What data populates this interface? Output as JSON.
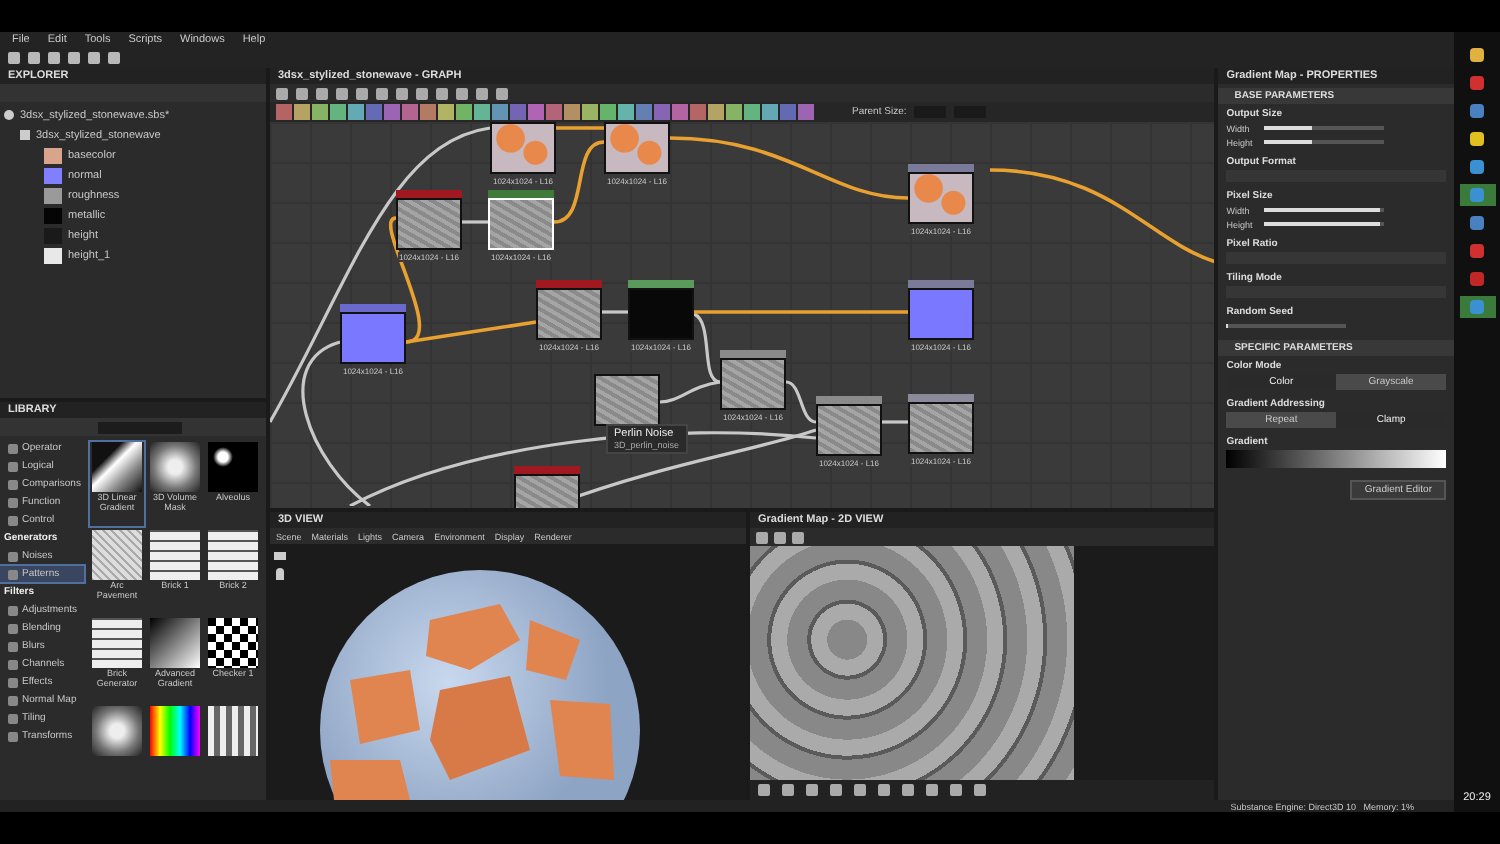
{
  "menu": [
    "File",
    "Edit",
    "Tools",
    "Scripts",
    "Windows",
    "Help"
  ],
  "explorer": {
    "title": "EXPLORER",
    "package": "3dsx_stylized_stonewave.sbs*",
    "graph": "3dsx_stylized_stonewave",
    "outputs": [
      {
        "label": "basecolor",
        "color": "#d9a48c"
      },
      {
        "label": "normal",
        "color": "#7f7fff"
      },
      {
        "label": "roughness",
        "color": "#9a9a9a"
      },
      {
        "label": "metallic",
        "color": "#050505"
      },
      {
        "label": "height",
        "color": "#1a1a1a"
      },
      {
        "label": "height_1",
        "color": "#e8e8e8"
      }
    ]
  },
  "library": {
    "title": "LIBRARY",
    "categories": [
      {
        "kind": "item",
        "label": "Operator",
        "selected": false
      },
      {
        "kind": "item",
        "label": "Logical",
        "selected": false
      },
      {
        "kind": "item",
        "label": "Comparisons",
        "selected": false
      },
      {
        "kind": "item",
        "label": "Function",
        "selected": false
      },
      {
        "kind": "item",
        "label": "Control",
        "selected": false
      },
      {
        "kind": "group",
        "label": "Generators",
        "children": [
          {
            "label": "Noises",
            "selected": false
          },
          {
            "label": "Patterns",
            "selected": true
          }
        ]
      },
      {
        "kind": "group",
        "label": "Filters",
        "children": [
          {
            "label": "Adjustments",
            "selected": false
          },
          {
            "label": "Blending",
            "selected": false
          },
          {
            "label": "Blurs",
            "selected": false
          },
          {
            "label": "Channels",
            "selected": false
          },
          {
            "label": "Effects",
            "selected": false
          },
          {
            "label": "Normal Map",
            "selected": false
          },
          {
            "label": "Tiling",
            "selected": false
          },
          {
            "label": "Transforms",
            "selected": false
          }
        ]
      }
    ],
    "items": [
      {
        "kind": "wedge",
        "label": "3D Linear Gradient",
        "selected": true
      },
      {
        "kind": "cube",
        "label": "3D Volume Mask",
        "selected": false
      },
      {
        "kind": "blobs",
        "label": "Alveolus",
        "selected": false
      },
      {
        "kind": "noise",
        "label": "Arc Pavement",
        "selected": false
      },
      {
        "kind": "bricks",
        "label": "Brick 1",
        "selected": false
      },
      {
        "kind": "bricks",
        "label": "Brick 2",
        "selected": false
      },
      {
        "kind": "bricks",
        "label": "Brick Generator",
        "selected": false
      },
      {
        "kind": "ramp",
        "label": "Advanced Gradient",
        "selected": false
      },
      {
        "kind": "checker",
        "label": "Checker 1",
        "selected": false
      },
      {
        "kind": "cube",
        "selected": false
      },
      {
        "kind": "color",
        "selected": false
      },
      {
        "kind": "stripes",
        "selected": false
      }
    ]
  },
  "graph": {
    "title": "3dsx_stylized_stonewave - GRAPH",
    "parent_size_label": "Parent Size:",
    "nodes": [
      {
        "kind": "stone",
        "caption": "1024x1024 - L16",
        "selected": false
      },
      {
        "kind": "stone",
        "caption": "1024x1024 - L16",
        "selected": false
      },
      {
        "kind": "noise",
        "color": "#a01820",
        "caption": "1024x1024 - L16",
        "selected": false
      },
      {
        "kind": "noise",
        "color": "#3f7a3a",
        "caption": "1024x1024 - L16",
        "selected": true
      },
      {
        "kind": "normal",
        "color": "#6a6acc",
        "caption": "1024x1024 - L16",
        "selected": false
      },
      {
        "kind": "noise",
        "color": "#a01820",
        "caption": "1024x1024 - L16",
        "selected": false
      },
      {
        "kind": "dark",
        "color": "#5a9a5a",
        "caption": "1024x1024 - L16",
        "selected": false
      },
      {
        "kind": "stone",
        "color": "#7a7a9a",
        "caption": "1024x1024 - L16",
        "selected": false
      },
      {
        "kind": "normal",
        "color": "#7a7a9a",
        "caption": "1024x1024 - L16",
        "selected": false
      },
      {
        "kind": "noise",
        "color": "#8a8a8a",
        "caption": "1024x1024 - L16",
        "selected": false
      },
      {
        "kind": "noise",
        "selected": false
      },
      {
        "kind": "noise",
        "color": "#8a8a8a",
        "caption": "1024x1024 - L16",
        "selected": false
      },
      {
        "kind": "noise",
        "color": "#8a8a9a",
        "caption": "1024x1024 - L16",
        "selected": false
      },
      {
        "kind": "noise",
        "color": "#a01820",
        "selected": false
      }
    ],
    "tooltip": {
      "title": "Perlin Noise",
      "subtitle": "3D_perlin_noise"
    }
  },
  "view3d": {
    "title": "3D VIEW",
    "menu": [
      "Scene",
      "Materials",
      "Lights",
      "Camera",
      "Environment",
      "Display",
      "Renderer"
    ]
  },
  "view2d": {
    "title": "Gradient Map - 2D VIEW"
  },
  "properties": {
    "title": "Gradient Map - PROPERTIES",
    "sections": [
      {
        "title": "BASE PARAMETERS",
        "params": [
          {
            "kind": "sliders",
            "label": "Output Size",
            "sliders": [
              {
                "label": "Width",
                "level": 0.4
              },
              {
                "label": "Height",
                "level": 0.4
              }
            ]
          },
          {
            "kind": "dropdown",
            "label": "Output Format"
          },
          {
            "kind": "sliders",
            "label": "Pixel Size",
            "sliders": [
              {
                "label": "Width",
                "level": 0.96
              },
              {
                "label": "Height",
                "level": 0.96
              }
            ]
          },
          {
            "kind": "dropdown",
            "label": "Pixel Ratio"
          },
          {
            "kind": "dropdown",
            "label": "Tiling Mode"
          },
          {
            "kind": "sliders",
            "label": "Random Seed",
            "sliders": [
              {
                "level": 0.02
              }
            ]
          }
        ]
      },
      {
        "title": "SPECIFIC PARAMETERS",
        "params": [
          {
            "kind": "toggle",
            "label": "Color Mode",
            "options": [
              {
                "label": "Color",
                "selected": true
              },
              {
                "label": "Grayscale",
                "selected": false
              }
            ]
          },
          {
            "kind": "toggle",
            "label": "Gradient Addressing",
            "options": [
              {
                "label": "Repeat",
                "selected": false
              },
              {
                "label": "Clamp",
                "selected": true
              }
            ]
          },
          {
            "kind": "gradient",
            "label": "Gradient"
          }
        ]
      }
    ],
    "button": "Gradient Editor"
  },
  "status_bar": "Substance Engine: Direct3D 10   Memory: 1%",
  "taskbar": {
    "apps": [
      {
        "kind": "folder",
        "selected": false
      },
      {
        "kind": "red",
        "selected": false
      },
      {
        "kind": "doc",
        "selected": false
      },
      {
        "kind": "yellow",
        "selected": false
      },
      {
        "kind": "blue",
        "selected": false
      },
      {
        "kind": "blue",
        "selected": true
      },
      {
        "kind": "doc",
        "selected": false
      },
      {
        "kind": "red",
        "selected": false
      },
      {
        "kind": "bar",
        "selected": false
      },
      {
        "kind": "blue",
        "selected": true
      }
    ],
    "clock": "20:29"
  }
}
